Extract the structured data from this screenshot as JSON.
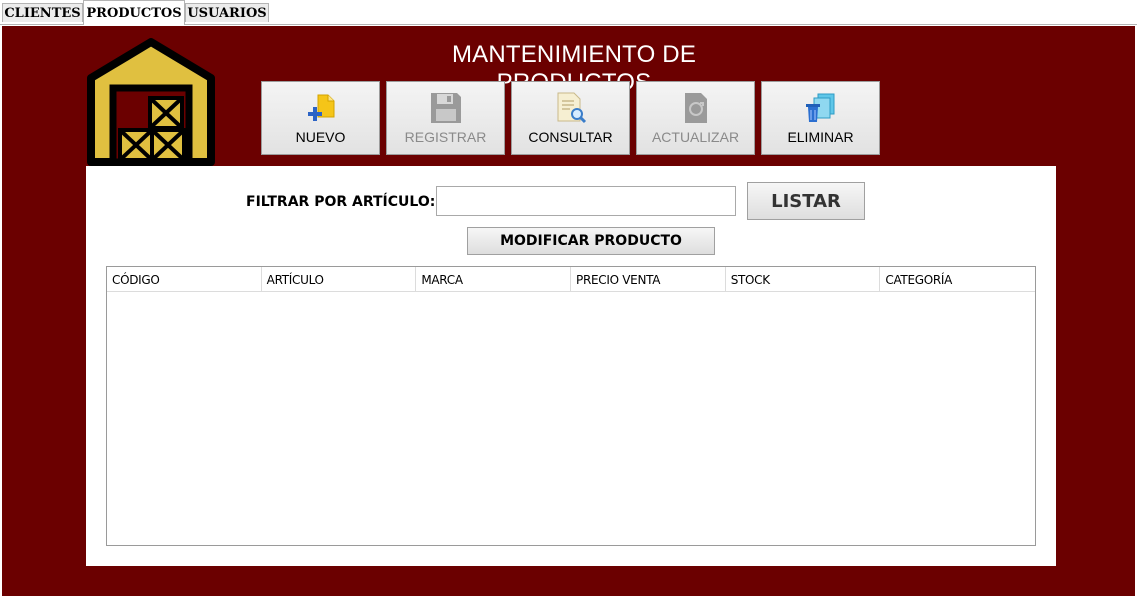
{
  "tabs": [
    {
      "label": "CLIENTES",
      "active": false
    },
    {
      "label": "PRODUCTOS",
      "active": true
    },
    {
      "label": "USUARIOS",
      "active": false
    }
  ],
  "header": {
    "title": "MANTENIMIENTO DE PRODUCTOS",
    "logo_icon": "warehouse-icon"
  },
  "toolbar": [
    {
      "label": "NUEVO",
      "icon": "new-document-icon",
      "enabled": true
    },
    {
      "label": "REGISTRAR",
      "icon": "floppy-disk-icon",
      "enabled": false
    },
    {
      "label": "CONSULTAR",
      "icon": "search-document-icon",
      "enabled": true
    },
    {
      "label": "ACTUALIZAR",
      "icon": "refresh-document-icon",
      "enabled": false
    },
    {
      "label": "ELIMINAR",
      "icon": "trash-icon",
      "enabled": true
    }
  ],
  "filter": {
    "label": "FILTRAR POR ARTÍCULO:",
    "value": "",
    "placeholder": "",
    "list_button": "LISTAR",
    "modify_button": "MODIFICAR PRODUCTO"
  },
  "table": {
    "columns": [
      "CÓDIGO",
      "ARTÍCULO",
      "MARCA",
      "PRECIO VENTA",
      "STOCK",
      "CATEGORÍA"
    ],
    "rows": []
  },
  "colors": {
    "panel_background": "#6b0000",
    "content_background": "#ffffff",
    "logo_fill": "#e0c040"
  }
}
